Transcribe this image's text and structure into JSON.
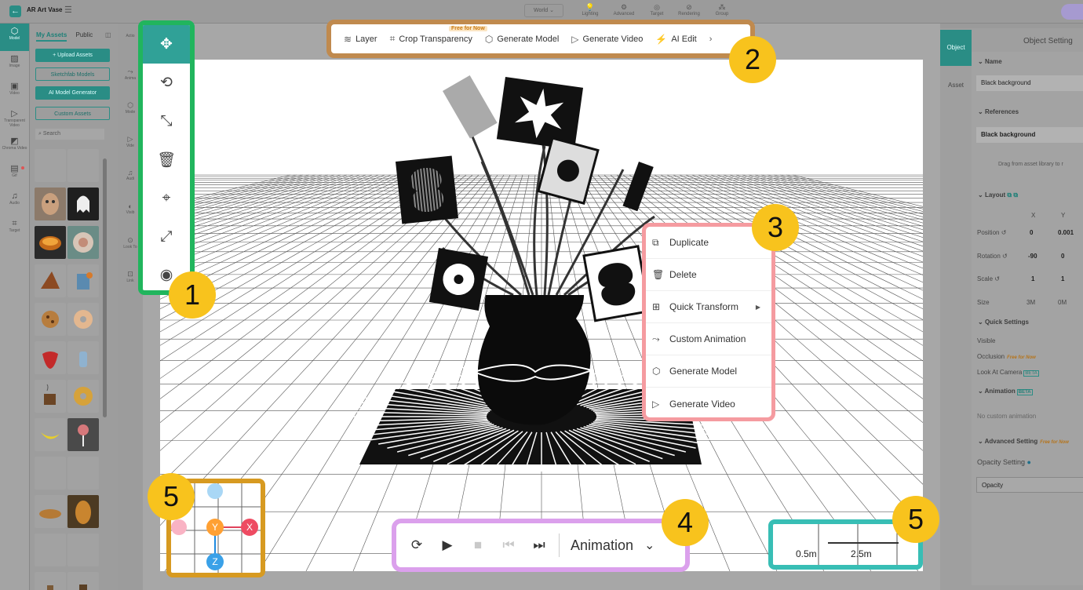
{
  "topbar": {
    "project_title": "AR Art Vase",
    "world_label": "World",
    "tools": [
      "Lighting",
      "Advanced",
      "Target",
      "Rendering",
      "Group"
    ]
  },
  "rail": [
    "Model",
    "Image",
    "Video",
    "Transparent Video",
    "Chroma Video",
    "Gif",
    "Audio",
    "Target"
  ],
  "assets": {
    "tabs": [
      "My Assets",
      "Public"
    ],
    "buttons": [
      "+ Upload Assets",
      "Sketchfab Models",
      "AI Model Generator",
      "Custom Assets"
    ],
    "search_placeholder": "Search"
  },
  "subcolumn": [
    "Actio",
    "Anima",
    "Mode",
    "Vide",
    "Audi",
    "Visib",
    "Look To",
    "Link"
  ],
  "toolbar1": {
    "icons": [
      "move-icon",
      "rotate-icon",
      "scale-icon",
      "delete-icon",
      "target-icon",
      "resize-icon",
      "visibility-icon"
    ],
    "glyphs": [
      "✥",
      "⟲",
      "⤡",
      "🗑",
      "⌖",
      "⤢",
      "◉"
    ],
    "badge": "1"
  },
  "toolbar2": {
    "items": [
      "Layer",
      "Crop Transparency",
      "Generate Model",
      "Generate Video",
      "AI Edit"
    ],
    "free_tag": "Free for Now",
    "badge": "2"
  },
  "context_menu": {
    "items": [
      "Duplicate",
      "Delete",
      "Quick Transform",
      "Custom Animation",
      "Generate Model",
      "Generate Video"
    ],
    "glyphs": [
      "⧉",
      "🗑",
      "⊞",
      "⤳",
      "⬡",
      "▷"
    ],
    "badge": "3"
  },
  "playback": {
    "animation_label": "Animation",
    "badge": "4"
  },
  "gizmo": {
    "axes": [
      "Y",
      "X",
      "Z"
    ],
    "badge": "5"
  },
  "scale_bar": {
    "labels": [
      "0.5m",
      "2.5m"
    ],
    "badge": "5"
  },
  "right_panel": {
    "tabs": [
      "Object",
      "Asset"
    ],
    "title": "Object Setting",
    "name_header": "Name",
    "name_value": "Black background",
    "references_header": "References",
    "reference_value": "Black background",
    "drag_hint": "Drag from asset library to r",
    "layout_header": "Layout",
    "axis_labels": [
      "X",
      "Y"
    ],
    "position": {
      "label": "Position",
      "x": "0",
      "y": "0.001"
    },
    "rotation": {
      "label": "Rotation",
      "x": "-90",
      "y": "0"
    },
    "scale": {
      "label": "Scale",
      "x": "1",
      "y": "1"
    },
    "size": {
      "label": "Size",
      "x": "3M",
      "y": "0M"
    },
    "quick_settings_header": "Quick Settings",
    "quick_items": [
      "Visible",
      "Occlusion",
      "Look At Camera"
    ],
    "free_tag": "Free for Now",
    "beta_tag": "BETA",
    "animation_header": "Animation",
    "no_animation": "No custom animation",
    "advanced_header": "Advanced Setting",
    "opacity_setting": "Opacity Setting",
    "opacity_field": "Opacity"
  }
}
